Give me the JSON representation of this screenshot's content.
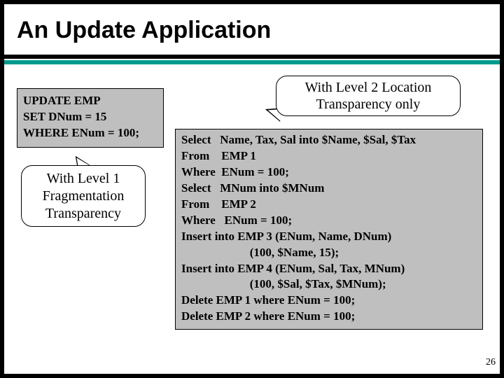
{
  "title": "An Update Application",
  "left_code": "UPDATE EMP\nSET DNum = 15\nWHERE ENum = 100;",
  "left_callout": "With Level 1\nFragmentation\nTransparency",
  "right_callout": "With Level 2 Location\nTransparency only",
  "right_code": "Select   Name, Tax, Sal into $Name, $Sal, $Tax\nFrom    EMP 1\nWhere  ENum = 100;\nSelect   MNum into $MNum\nFrom    EMP 2\nWhere   ENum = 100;\nInsert into EMP 3 (ENum, Name, DNum)\n                       (100, $Name, 15);\nInsert into EMP 4 (ENum, Sal, Tax, MNum)\n                       (100, $Sal, $Tax, $MNum);\nDelete EMP 1 where ENum = 100;\nDelete EMP 2 where ENum = 100;",
  "page_number": "26"
}
